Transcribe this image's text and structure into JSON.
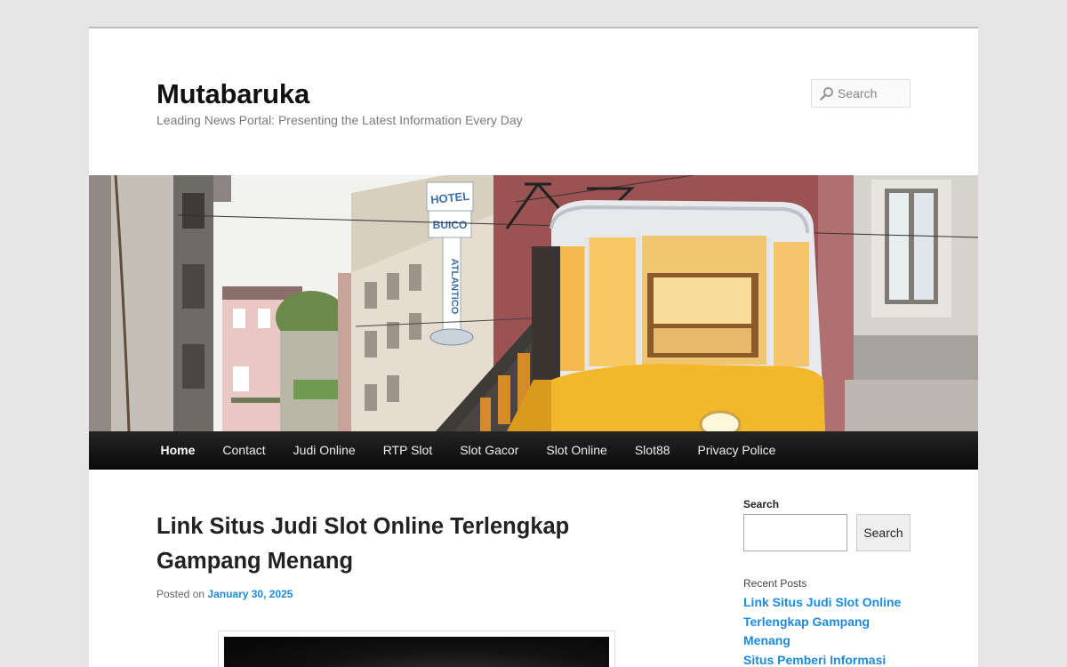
{
  "site": {
    "title": "Mutabaruka",
    "description": "Leading News Portal: Presenting the Latest Information Every Day"
  },
  "header_search": {
    "placeholder": "Search",
    "icon": "search-icon"
  },
  "banner": {
    "sign_lines": [
      "HOTEL",
      "BUICO",
      "ATLANTICO"
    ]
  },
  "nav": {
    "items": [
      {
        "label": "Home",
        "current": true
      },
      {
        "label": "Contact"
      },
      {
        "label": "Judi Online"
      },
      {
        "label": "RTP Slot"
      },
      {
        "label": "Slot Gacor"
      },
      {
        "label": "Slot Online"
      },
      {
        "label": "Slot88"
      },
      {
        "label": "Privacy Police"
      }
    ]
  },
  "post": {
    "title": "Link Situs Judi Slot Online Terlengkap Gampang Menang",
    "posted_on_label": "Posted on",
    "date": "January 30, 2025"
  },
  "sidebar": {
    "search_label": "Search",
    "search_button": "Search",
    "recent_posts_title": "Recent Posts",
    "recent_posts": [
      "Link Situs Judi Slot Online Terlengkap Gampang Menang",
      "Situs Pemberi Informasi Slot Online Terpercaya"
    ]
  },
  "colors": {
    "link": "#1b8be0",
    "nav_bg": "#111111",
    "page_bg": "#e6e6e6",
    "tram_yellow": "#f3b72a"
  }
}
